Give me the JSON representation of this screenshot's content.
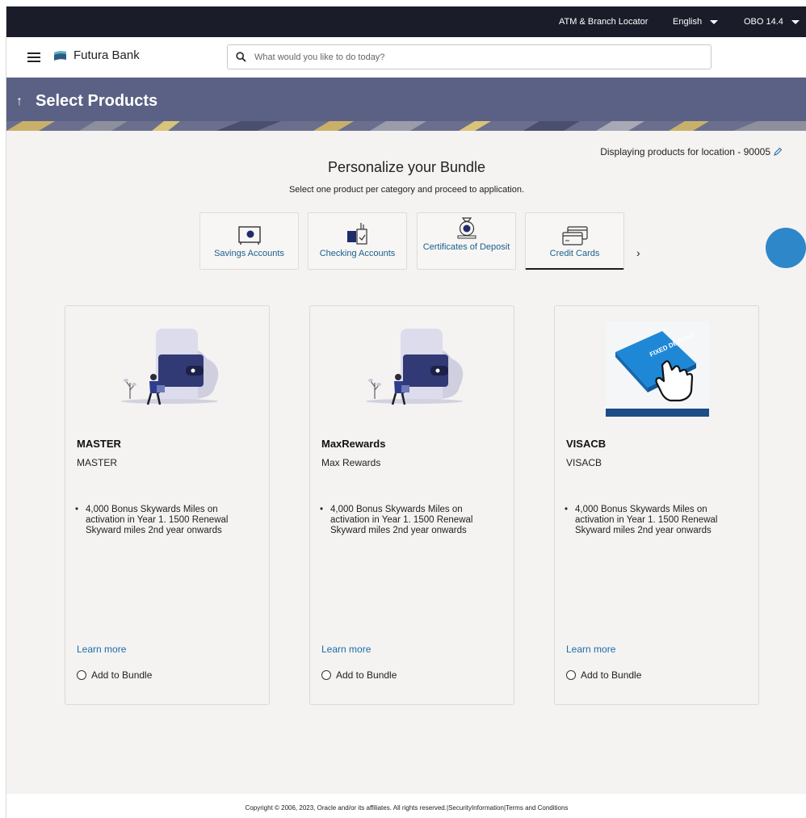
{
  "topbar": {
    "locator": "ATM & Branch Locator",
    "language": "English",
    "version": "OBO 14.4"
  },
  "header": {
    "brand": "Futura Bank",
    "search_placeholder": "What would you like to do today?"
  },
  "banner": {
    "title": "Select Products"
  },
  "location_text": "Displaying products for location - 90005",
  "page_title": "Personalize your Bundle",
  "page_subtitle": "Select one product per category and proceed to application.",
  "categories": [
    {
      "label": "Savings Accounts",
      "active": false
    },
    {
      "label": "Checking Accounts",
      "active": false
    },
    {
      "label": "Certificates of Deposit",
      "active": false
    },
    {
      "label": "Credit Cards",
      "active": true
    }
  ],
  "products": [
    {
      "name": "MASTER",
      "description": "MASTER",
      "feature": "4,000 Bonus Skywards Miles on activation in Year 1. 1500 Renewal Skyward miles 2nd year onwards",
      "learn_more": "Learn more",
      "add_label": "Add to Bundle",
      "image": "wallet-illustration"
    },
    {
      "name": "MaxRewards",
      "description": "Max Rewards",
      "feature": "4,000 Bonus Skywards Miles on activation in Year 1. 1500 Renewal Skyward miles 2nd year onwards",
      "learn_more": "Learn more",
      "add_label": "Add to Bundle",
      "image": "wallet-illustration"
    },
    {
      "name": "VISACB",
      "description": "VISACB",
      "feature": "4,000 Bonus Skywards Miles on activation in Year 1. 1500 Renewal Skyward miles 2nd year onwards",
      "learn_more": "Learn more",
      "add_label": "Add to Bundle",
      "image": "fixed-deposit-button-photo",
      "image_text": "FIXED DEPOSIT"
    }
  ],
  "footer": {
    "copyright": "Copyright © 2006, 2023, Oracle and/or its affiliates. All rights reserved.",
    "security": "SecurityInformation",
    "terms": "Terms and Conditions"
  },
  "colors": {
    "topbar": "#1b1c29",
    "banner": "#5b6184",
    "link": "#1b6ea8",
    "page_bg": "#f4f3f2"
  }
}
